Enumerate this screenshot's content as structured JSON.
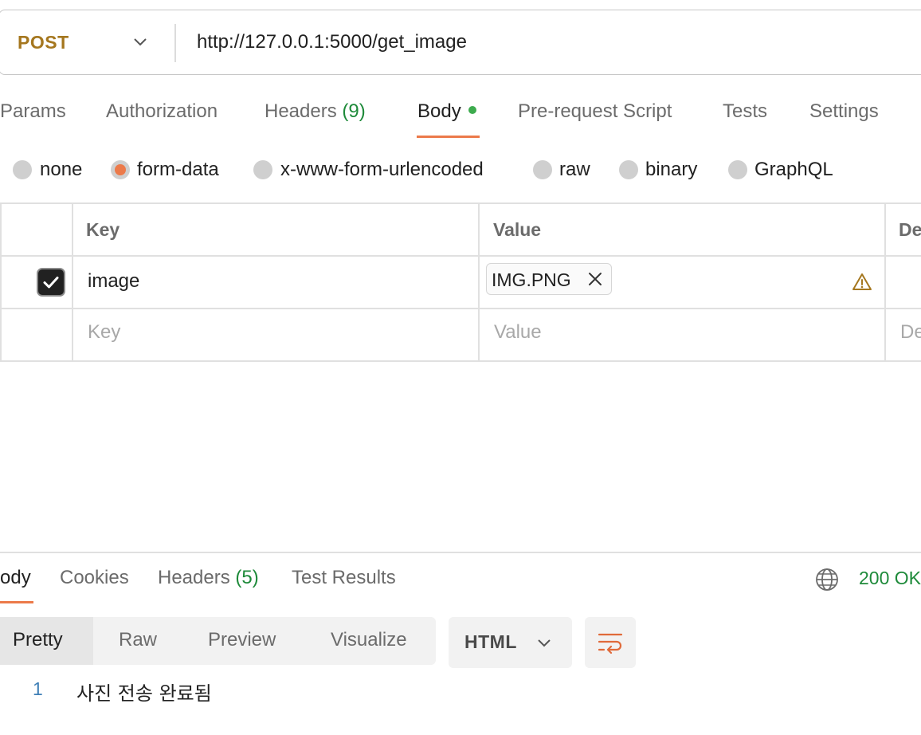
{
  "request": {
    "method": "POST",
    "url": "http://127.0.0.1:5000/get_image"
  },
  "request_tabs": [
    {
      "label": "Params"
    },
    {
      "label": "Authorization"
    },
    {
      "label": "Headers",
      "count": "(9)"
    },
    {
      "label": "Body"
    },
    {
      "label": "Pre-request Script"
    },
    {
      "label": "Tests"
    },
    {
      "label": "Settings"
    }
  ],
  "body_types": {
    "options": [
      "none",
      "form-data",
      "x-www-form-urlencoded",
      "raw",
      "binary",
      "GraphQL"
    ],
    "selected": "form-data"
  },
  "form_table": {
    "headers": {
      "key": "Key",
      "value": "Value",
      "description": "De"
    },
    "rows": [
      {
        "checked": true,
        "key": "image",
        "file": "IMG.PNG"
      }
    ],
    "new_row": {
      "key_placeholder": "Key",
      "value_placeholder": "Value",
      "description_placeholder": "De"
    }
  },
  "response": {
    "tabs": [
      {
        "label": "ody"
      },
      {
        "label": "Cookies"
      },
      {
        "label": "Headers",
        "count": "(5)"
      },
      {
        "label": "Test Results"
      }
    ],
    "status": "200 OK",
    "view_modes": [
      "Pretty",
      "Raw",
      "Preview",
      "Visualize"
    ],
    "active_view": "Pretty",
    "format": "HTML",
    "lines": [
      {
        "number": "1",
        "content": "사진 전송 완료됨"
      }
    ]
  },
  "colors": {
    "accent": "#ec7a4a",
    "method": "#a5771f",
    "success": "#1e8a3a",
    "line_number": "#3f7fb6"
  },
  "icons": [
    "chevron-down-icon",
    "check-icon",
    "close-icon",
    "warning-icon",
    "globe-icon",
    "wrap-lines-icon"
  ]
}
